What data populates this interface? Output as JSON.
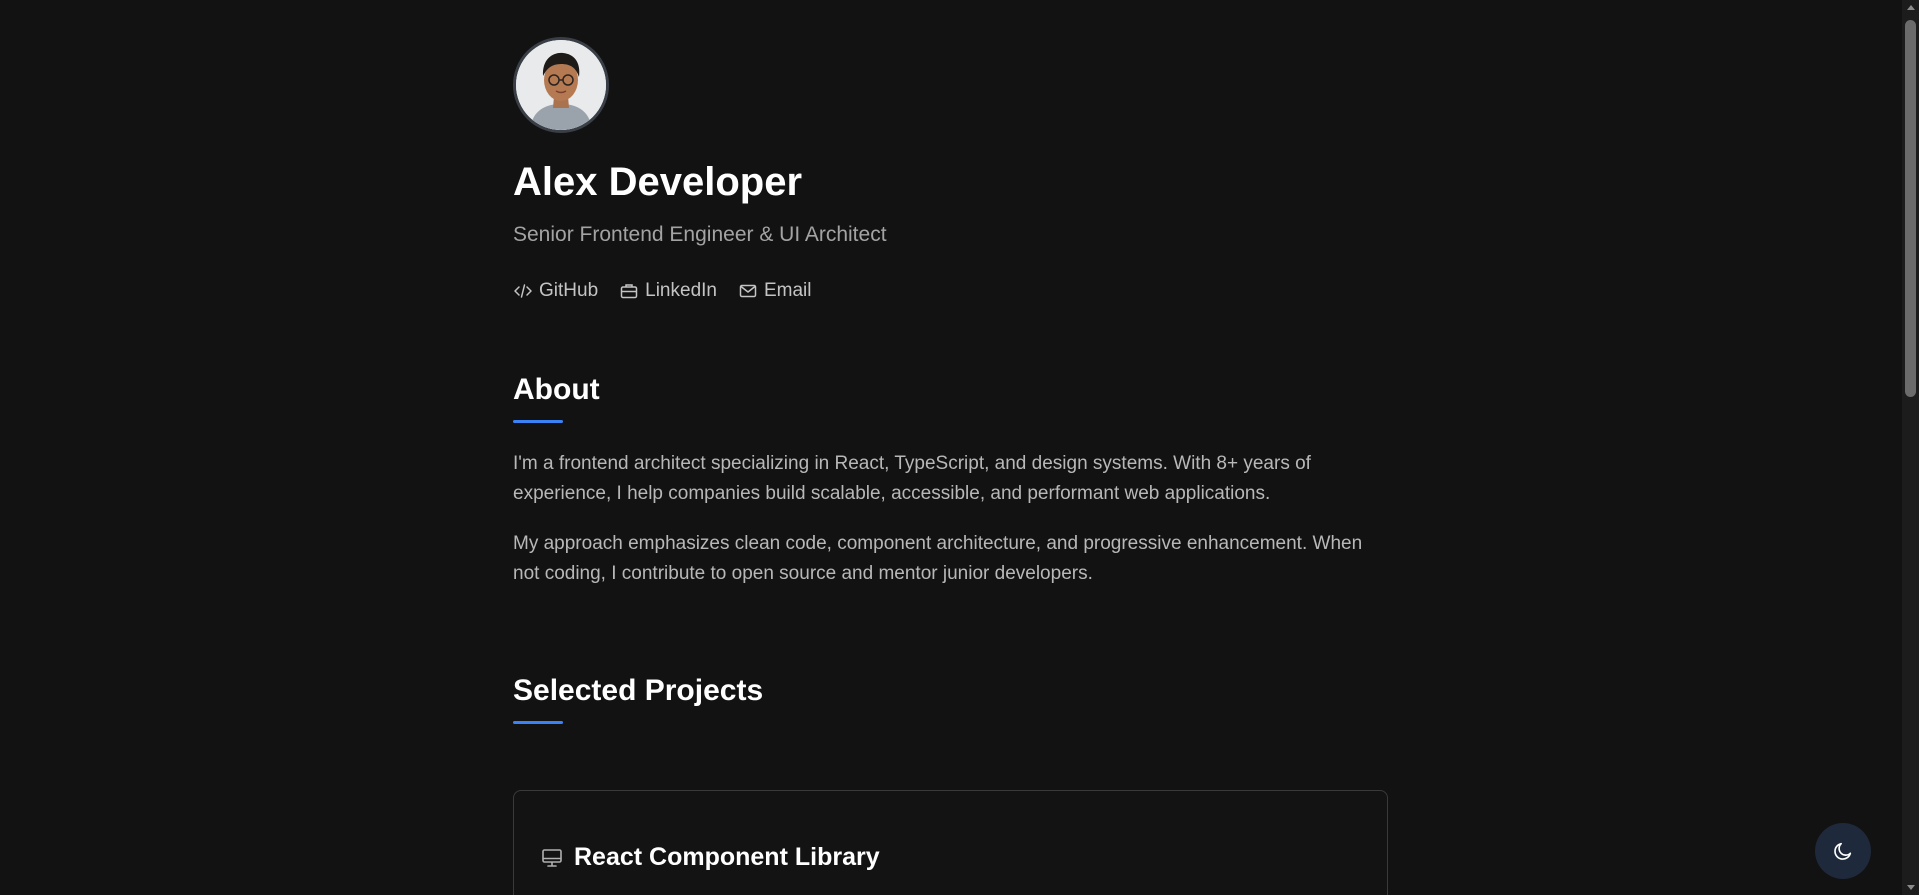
{
  "profile": {
    "name": "Alex Developer",
    "title": "Senior Frontend Engineer & UI Architect",
    "avatar_icon": "avatar-portrait"
  },
  "links": [
    {
      "label": "GitHub",
      "icon": "code-icon"
    },
    {
      "label": "LinkedIn",
      "icon": "briefcase-icon"
    },
    {
      "label": "Email",
      "icon": "mail-icon"
    }
  ],
  "about": {
    "heading": "About",
    "paragraphs": [
      "I'm a frontend architect specializing in React, TypeScript, and design systems. With 8+ years of experience, I help companies build scalable, accessible, and performant web applications.",
      "My approach emphasizes clean code, component architecture, and progressive enhancement. When not coding, I contribute to open source and mentor junior developers."
    ]
  },
  "projects": {
    "heading": "Selected Projects",
    "items": [
      {
        "title": "React Component Library",
        "icon": "monitor-icon"
      }
    ]
  },
  "theme_toggle": {
    "icon": "moon-icon"
  },
  "colors": {
    "background": "#121212",
    "accent": "#3b82f6",
    "text_primary": "#ffffff",
    "text_secondary": "#a3a3a3",
    "toggle_bg": "#1e293b"
  }
}
